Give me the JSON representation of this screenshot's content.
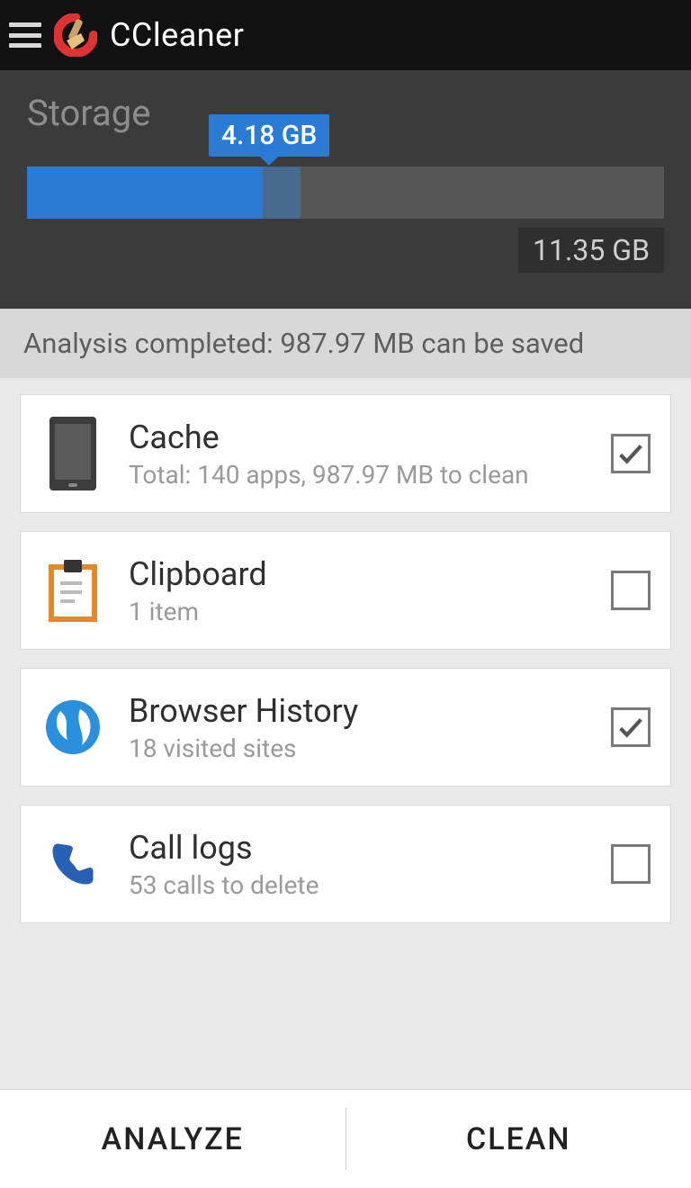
{
  "header": {
    "app_title": "CCleaner"
  },
  "storage": {
    "label": "Storage",
    "used_label": "4.18 GB",
    "total_label": "11.35 GB",
    "used_percent": 37,
    "extra_percent": 6
  },
  "status": {
    "text": "Analysis completed: 987.97 MB can be saved"
  },
  "items": [
    {
      "title": "Cache",
      "subtitle": "Total: 140 apps, 987.97 MB to clean",
      "checked": true,
      "icon": "phone-icon"
    },
    {
      "title": "Clipboard",
      "subtitle": "1 item",
      "checked": false,
      "icon": "clipboard-icon"
    },
    {
      "title": "Browser History",
      "subtitle": "18 visited sites",
      "checked": true,
      "icon": "globe-icon"
    },
    {
      "title": "Call logs",
      "subtitle": "53 calls to delete",
      "checked": false,
      "icon": "phone-call-icon"
    }
  ],
  "footer": {
    "analyze": "ANALYZE",
    "clean": "CLEAN"
  }
}
